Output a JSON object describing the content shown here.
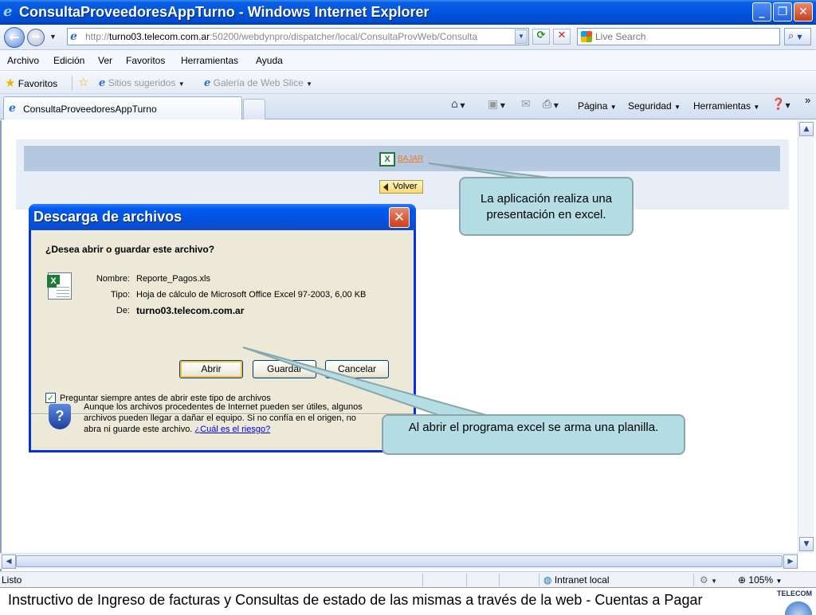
{
  "window": {
    "title": "ConsultaProveedoresAppTurno - Windows Internet Explorer"
  },
  "address": {
    "url_prefix": "http://",
    "url_host": "turno03.telecom.com.ar",
    "url_rest": ":50200/webdynpro/dispatcher/local/ConsultaProvWeb/Consulta",
    "search_placeholder": "Live Search"
  },
  "menu": [
    "Archivo",
    "Edición",
    "Ver",
    "Favoritos",
    "Herramientas",
    "Ayuda"
  ],
  "favorites": {
    "label": "Favoritos",
    "suggested": "Sitios sugeridos",
    "webslice": "Galería de Web Slice"
  },
  "tab": {
    "label": "ConsultaProveedoresAppTurno"
  },
  "commands": {
    "page": "Página",
    "security": "Seguridad",
    "tools": "Herramientas"
  },
  "page": {
    "bajar": "BAJAR",
    "volver": "Volver"
  },
  "dialog": {
    "title": "Descarga de archivos",
    "question": "¿Desea abrir o guardar este archivo?",
    "name_label": "Nombre:",
    "name_value": "Reporte_Pagos.xls",
    "type_label": "Tipo:",
    "type_value": "Hoja de cálculo de Microsoft Office Excel 97-2003, 6,00 KB",
    "from_label": "De:",
    "from_value": "turno03.telecom.com.ar",
    "open": "Abrir",
    "save": "Guardar",
    "cancel": "Cancelar",
    "checkbox": "Preguntar siempre antes de abrir este tipo de archivos",
    "warning": "Aunque los archivos procedentes de Internet pueden ser útiles, algunos archivos pueden llegar a dañar el equipo. Si no confía en el origen, no abra ni guarde este archivo.",
    "risk_link": "¿Cuál es el riesgo?"
  },
  "callouts": {
    "excel_presentation": "La aplicación realiza una presentación en excel.",
    "excel_sheet": "Al abrir el programa excel  se arma una planilla."
  },
  "status": {
    "text": "Listo",
    "zone": "Intranet local",
    "zoom": "105%"
  },
  "footer": {
    "text": "Instructivo de Ingreso de facturas y Consultas de estado de las mismas a través de la web    -    Cuentas a Pagar",
    "logo": "TELECOM"
  }
}
